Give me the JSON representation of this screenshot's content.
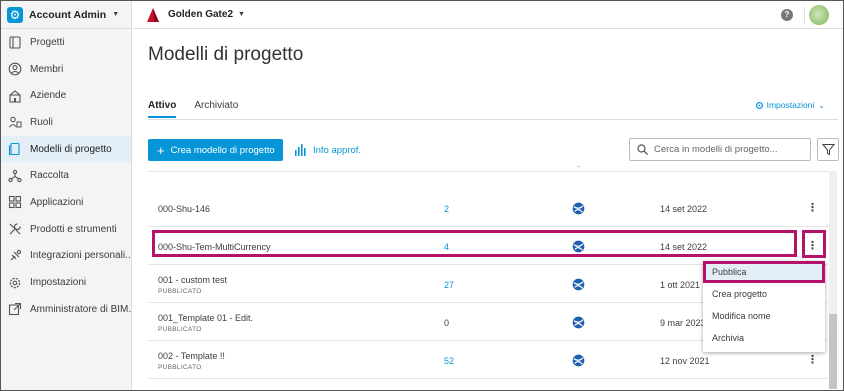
{
  "account": {
    "name": "Account Admin"
  },
  "project": {
    "name": "Golden Gate2"
  },
  "sidebar": {
    "items": [
      {
        "label": "Progetti",
        "icon": "folder-icon",
        "active": false
      },
      {
        "label": "Membri",
        "icon": "user-icon",
        "active": false
      },
      {
        "label": "Aziende",
        "icon": "building-icon",
        "active": false
      },
      {
        "label": "Ruoli",
        "icon": "roles-icon",
        "active": false
      },
      {
        "label": "Modelli di progetto",
        "icon": "template-icon",
        "active": true
      },
      {
        "label": "Raccolta",
        "icon": "network-icon",
        "active": false
      },
      {
        "label": "Applicazioni",
        "icon": "apps-grid-icon",
        "active": false
      },
      {
        "label": "Prodotti e strumenti",
        "icon": "tools-icon",
        "active": false
      },
      {
        "label": "Integrazioni personali...",
        "icon": "integrations-icon",
        "active": false
      },
      {
        "label": "Impostazioni",
        "icon": "gear-icon",
        "active": false
      },
      {
        "label": "Amministratore di BIM...",
        "icon": "external-link-icon",
        "active": false
      }
    ]
  },
  "main": {
    "title": "Modelli di progetto",
    "tabs": [
      {
        "label": "Attivo",
        "active": true
      },
      {
        "label": "Archiviato",
        "active": false
      }
    ],
    "settings_label": "Impostazioni",
    "create_button": "Crea modello di progetto",
    "info_link": "Info approf.",
    "search_placeholder": "Cerca in modelli di progetto...",
    "rows": [
      {
        "name": "000-Shu-146",
        "status": "",
        "count": "2",
        "count_link": true,
        "date": "14 set 2022"
      },
      {
        "name": "000-Shu-Tem-MultiCurrency",
        "status": "",
        "count": "4",
        "count_link": true,
        "date": "14 set 2022"
      },
      {
        "name": "001 - custom test",
        "status": "PUBBLICATO",
        "count": "27",
        "count_link": true,
        "date": "1 ott 2021"
      },
      {
        "name": "001_Template 01 - Edit.",
        "status": "PUBBLICATO",
        "count": "0",
        "count_link": false,
        "date": "9 mar 2023"
      },
      {
        "name": "002 - Template !!",
        "status": "PUBBLICATO",
        "count": "52",
        "count_link": true,
        "date": "12 nov 2021"
      }
    ]
  },
  "context_menu": {
    "items": [
      "Pubblica",
      "Crea progetto",
      "Modifica nome",
      "Archivia"
    ]
  },
  "colors": {
    "accent": "#0696d7",
    "highlight": "#b5126b"
  }
}
